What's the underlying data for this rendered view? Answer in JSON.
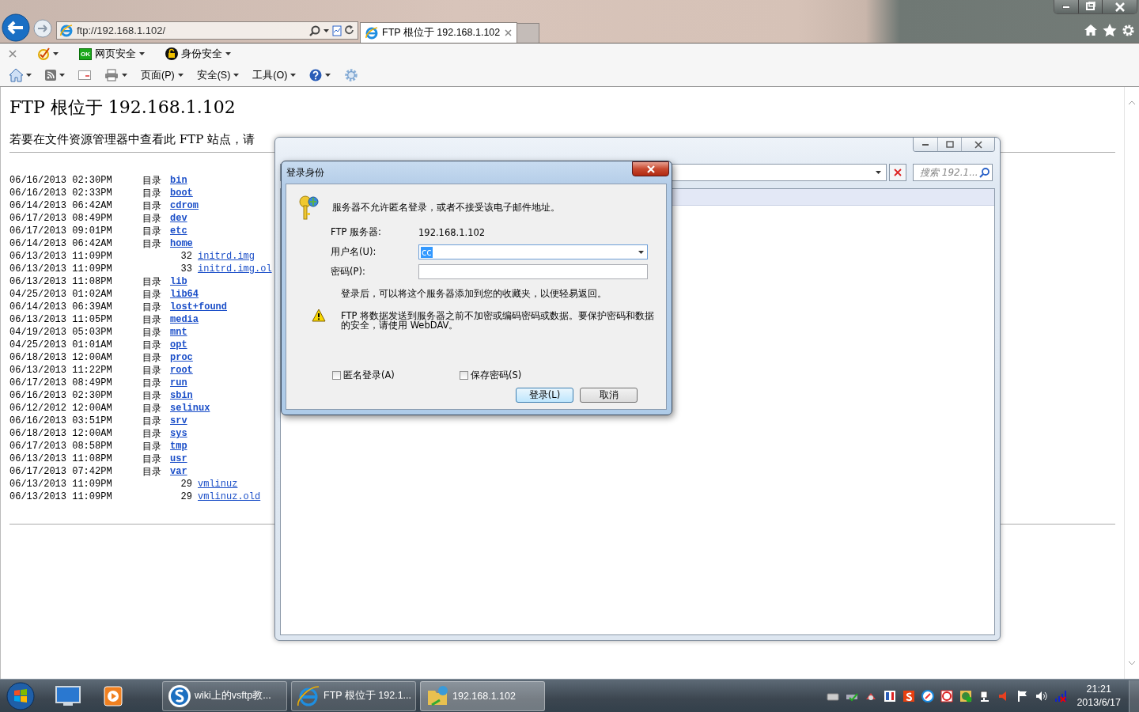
{
  "browser": {
    "address": "ftp://192.168.1.102/",
    "tabs": [
      {
        "label": "FTP 根位于 192.168.1.102",
        "selected": true
      }
    ],
    "toolbar_1": [
      {
        "kind": "close"
      },
      {
        "kind": "check"
      },
      {
        "kind": "badge",
        "badge": "OK",
        "label": "网页安全"
      },
      {
        "kind": "lock",
        "label": "身份安全"
      }
    ],
    "toolbar_2": [
      {
        "kind": "home"
      },
      {
        "kind": "feed"
      },
      {
        "kind": "mail"
      },
      {
        "kind": "print"
      },
      {
        "kind": "menu",
        "label": "页面(P)"
      },
      {
        "kind": "menu",
        "label": "安全(S)"
      },
      {
        "kind": "menu",
        "label": "工具(O)"
      },
      {
        "kind": "help"
      },
      {
        "kind": "gear"
      }
    ]
  },
  "page": {
    "title": "FTP 根位于 192.168.1.102",
    "hint": "若要在文件资源管理器中查看此 FTP 站点，请",
    "listing": [
      {
        "date": "06/16/2013 02:30PM",
        "kind": "dir",
        "type": "目录",
        "name": "bin"
      },
      {
        "date": "06/16/2013 02:33PM",
        "kind": "dir",
        "type": "目录",
        "name": "boot"
      },
      {
        "date": "06/14/2013 06:42AM",
        "kind": "dir",
        "type": "目录",
        "name": "cdrom"
      },
      {
        "date": "06/17/2013 08:49PM",
        "kind": "dir",
        "type": "目录",
        "name": "dev"
      },
      {
        "date": "06/17/2013 09:01PM",
        "kind": "dir",
        "type": "目录",
        "name": "etc"
      },
      {
        "date": "06/14/2013 06:42AM",
        "kind": "dir",
        "type": "目录",
        "name": "home"
      },
      {
        "date": "06/13/2013 11:09PM",
        "kind": "file",
        "size": "32",
        "name": "initrd.img"
      },
      {
        "date": "06/13/2013 11:09PM",
        "kind": "file",
        "size": "33",
        "name": "initrd.img.ol"
      },
      {
        "date": "06/13/2013 11:08PM",
        "kind": "dir",
        "type": "目录",
        "name": "lib"
      },
      {
        "date": "04/25/2013 01:02AM",
        "kind": "dir",
        "type": "目录",
        "name": "lib64"
      },
      {
        "date": "06/14/2013 06:39AM",
        "kind": "dir",
        "type": "目录",
        "name": "lost+found"
      },
      {
        "date": "06/13/2013 11:05PM",
        "kind": "dir",
        "type": "目录",
        "name": "media"
      },
      {
        "date": "04/19/2013 05:03PM",
        "kind": "dir",
        "type": "目录",
        "name": "mnt"
      },
      {
        "date": "04/25/2013 01:01AM",
        "kind": "dir",
        "type": "目录",
        "name": "opt"
      },
      {
        "date": "06/18/2013 12:00AM",
        "kind": "dir",
        "type": "目录",
        "name": "proc"
      },
      {
        "date": "06/13/2013 11:22PM",
        "kind": "dir",
        "type": "目录",
        "name": "root"
      },
      {
        "date": "06/17/2013 08:49PM",
        "kind": "dir",
        "type": "目录",
        "name": "run"
      },
      {
        "date": "06/16/2013 02:30PM",
        "kind": "dir",
        "type": "目录",
        "name": "sbin"
      },
      {
        "date": "06/12/2012 12:00AM",
        "kind": "dir",
        "type": "目录",
        "name": "selinux"
      },
      {
        "date": "06/16/2013 03:51PM",
        "kind": "dir",
        "type": "目录",
        "name": "srv"
      },
      {
        "date": "06/18/2013 12:00AM",
        "kind": "dir",
        "type": "目录",
        "name": "sys"
      },
      {
        "date": "06/17/2013 08:58PM",
        "kind": "dir",
        "type": "目录",
        "name": "tmp"
      },
      {
        "date": "06/13/2013 11:08PM",
        "kind": "dir",
        "type": "目录",
        "name": "usr"
      },
      {
        "date": "06/17/2013 07:42PM",
        "kind": "dir",
        "type": "目录",
        "name": "var"
      },
      {
        "date": "06/13/2013 11:09PM",
        "kind": "file",
        "size": "29",
        "name": "vmlinuz"
      },
      {
        "date": "06/13/2013 11:09PM",
        "kind": "file",
        "size": "29",
        "name": "vmlinuz.old"
      }
    ]
  },
  "explorer_window": {
    "search_placeholder": "搜索 192.1..."
  },
  "dialog": {
    "title": "登录身份",
    "message": "服务器不允许匿名登录，或者不接受该电子邮件地址。",
    "fields": [
      {
        "kind": "text",
        "label": "FTP 服务器:",
        "value": "192.168.1.102"
      },
      {
        "kind": "combo",
        "label": "用户名(U):",
        "value": "cc"
      },
      {
        "kind": "password",
        "label": "密码(P):"
      }
    ],
    "note": "登录后，可以将这个服务器添加到您的收藏夹，以便轻易返回。",
    "warning": "FTP 将数据发送到服务器之前不加密或编码密码或数据。要保护密码和数据的安全，请使用 WebDAV。",
    "checkboxes": [
      {
        "label": "匿名登录(A)",
        "checked": false
      },
      {
        "label": "保存密码(S)",
        "checked": false
      }
    ],
    "buttons": [
      {
        "label": "登录(L)",
        "default": true
      },
      {
        "label": "取消",
        "default": false
      }
    ]
  },
  "taskbar": {
    "tasks": [
      {
        "kind": "sogou",
        "label": "wiki上的vsftp教...",
        "selected": false
      },
      {
        "kind": "ie",
        "label": "FTP 根位于 192.1...",
        "selected": false
      },
      {
        "kind": "folder",
        "label": "192.168.1.102",
        "selected": true
      }
    ],
    "clock": {
      "time": "21:21",
      "date": "2013/6/17"
    }
  }
}
